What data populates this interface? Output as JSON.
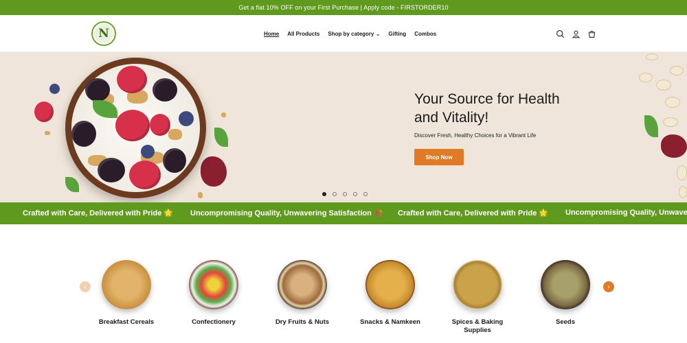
{
  "announcement": "Get a flat 10% OFF on your First Purchase | Apply code - FIRSTORDER10",
  "nav": {
    "home": "Home",
    "all_products": "All Products",
    "shop_by_category": "Shop by category",
    "gifting": "Gifting",
    "combos": "Combos"
  },
  "icons": [
    "search-icon",
    "account-icon",
    "cart-icon",
    "chevron-down-icon"
  ],
  "logo_letter": "N",
  "hero": {
    "title": "Your Source for Health and Vitality!",
    "subtitle": "Discover Fresh, Healthy Choices for a Vibrant Life",
    "cta": "Shop Now",
    "slides": 5,
    "active_slide": 1
  },
  "marquee": [
    "Crafted with Care, Delivered with Pride 🌟",
    "Uncompromising Quality, Unwavering Satisfaction 🍂",
    "Crafted with Care, Delivered with Pride 🌟",
    "Uncompromising Quality, Unwavering Satisfaction"
  ],
  "categories": [
    {
      "label": "Breakfast Cereals",
      "color": "#d9a860"
    },
    {
      "label": "Confectionery",
      "color": "#e0483c"
    },
    {
      "label": "Dry Fruits & Nuts",
      "color": "#b9895a"
    },
    {
      "label": "Snacks & Namkeen",
      "color": "#d8a13c"
    },
    {
      "label": "Spices & Baking Supplies",
      "color": "#c9a24a"
    },
    {
      "label": "Seeds",
      "color": "#9a8a5e"
    }
  ],
  "colors": {
    "brand_green": "#5f9a1e",
    "accent_orange": "#e07a24",
    "hero_bg": "#efe5da"
  }
}
